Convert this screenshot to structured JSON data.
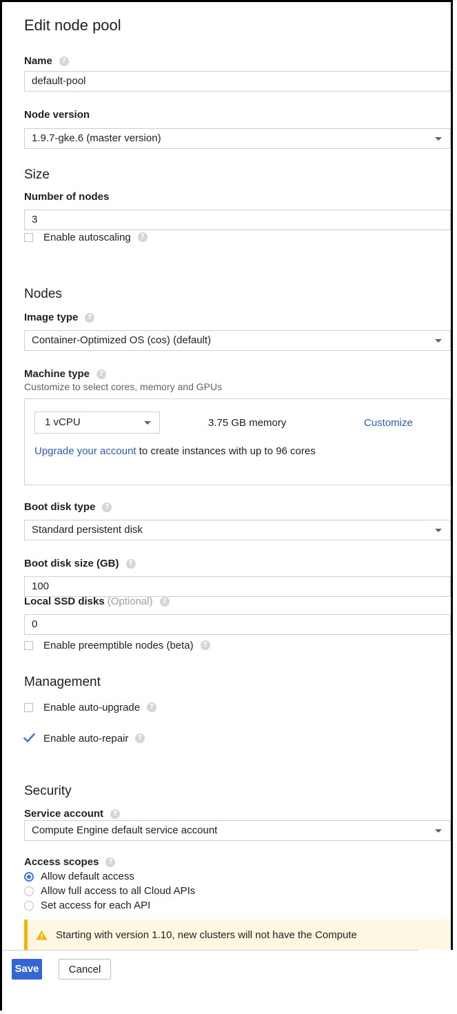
{
  "title": "Edit node pool",
  "name": {
    "label": "Name",
    "value": "default-pool"
  },
  "node_version": {
    "label": "Node version",
    "value": "1.9.7-gke.6 (master version)"
  },
  "size": {
    "heading": "Size",
    "num_nodes_label": "Number of nodes",
    "num_nodes_value": "3",
    "autoscaling_label": "Enable autoscaling",
    "autoscaling_checked": false
  },
  "nodes": {
    "heading": "Nodes",
    "image_type_label": "Image type",
    "image_type_value": "Container-Optimized OS (cos) (default)",
    "machine_type_label": "Machine type",
    "machine_type_sub": "Customize to select cores, memory and GPUs",
    "vcpu_value": "1 vCPU",
    "memory_text": "3.75 GB memory",
    "customize_link": "Customize",
    "upgrade_link": "Upgrade your account",
    "upgrade_rest": " to create instances with up to 96 cores",
    "boot_disk_type_label": "Boot disk type",
    "boot_disk_type_value": "Standard persistent disk",
    "boot_disk_size_label": "Boot disk size (GB)",
    "boot_disk_size_value": "100",
    "local_ssd_label": "Local SSD disks",
    "local_ssd_optional": "(Optional)",
    "local_ssd_value": "0",
    "preemptible_label": "Enable preemptible nodes (beta)",
    "preemptible_checked": false
  },
  "management": {
    "heading": "Management",
    "auto_upgrade_label": "Enable auto-upgrade",
    "auto_upgrade_checked": false,
    "auto_repair_label": "Enable auto-repair",
    "auto_repair_checked": true
  },
  "security": {
    "heading": "Security",
    "service_account_label": "Service account",
    "service_account_value": "Compute Engine default service account",
    "access_scopes_label": "Access scopes",
    "scopes": [
      {
        "label": "Allow default access",
        "selected": true
      },
      {
        "label": "Allow full access to all Cloud APIs",
        "selected": false
      },
      {
        "label": "Set access for each API",
        "selected": false
      }
    ]
  },
  "warning_text": "Starting with version 1.10, new clusters will not have the Compute",
  "footer": {
    "save_label": "Save",
    "cancel_label": "Cancel"
  },
  "colors": {
    "accent": "#3367d6",
    "link": "#2a5db0",
    "warning_border": "#f4b400",
    "warning_bg": "#fef8e2",
    "check": "#3d7bd6"
  },
  "icons": {
    "help": "help-circle-icon",
    "caret": "dropdown-caret-icon",
    "warning": "warning-triangle-icon",
    "check": "checkmark-icon"
  }
}
